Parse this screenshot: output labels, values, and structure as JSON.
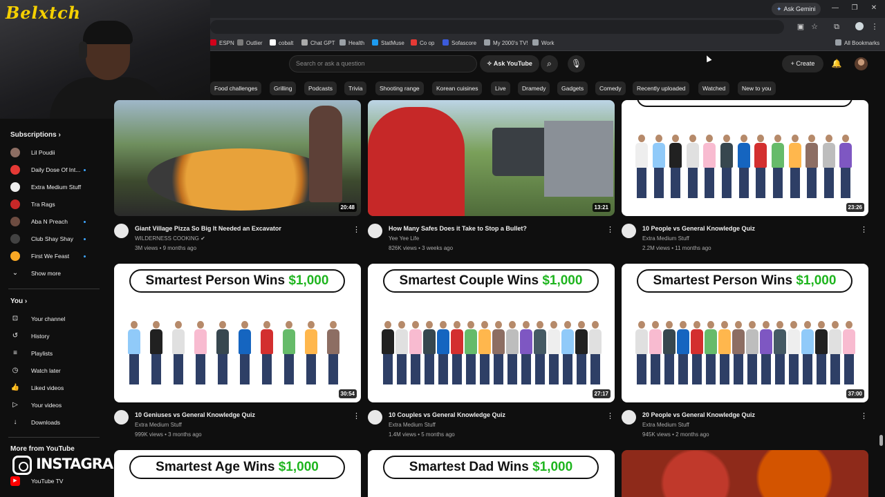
{
  "browser": {
    "ask_gemini": "Ask Gemini",
    "bookmarks": [
      {
        "label": "ESPN",
        "color": "#d0021b"
      },
      {
        "label": "Outlier",
        "color": "#7a7a7a"
      },
      {
        "label": "cobalt",
        "color": "#ffffff"
      },
      {
        "label": "Chat GPT",
        "color": "#aaaaaa"
      },
      {
        "label": "Health",
        "color": "#9aa0a6"
      },
      {
        "label": "StatMuse",
        "color": "#1d9bf0"
      },
      {
        "label": "Co op",
        "color": "#e53935"
      },
      {
        "label": "Sofascore",
        "color": "#3b5bdb"
      },
      {
        "label": "My 2000's TV!",
        "color": "#9aa0a6"
      },
      {
        "label": "Work",
        "color": "#9aa0a6"
      }
    ],
    "all_bookmarks": "All Bookmarks"
  },
  "overlay": {
    "streamer_logo": "Belxtch",
    "instagram": "INSTAGRAM"
  },
  "header": {
    "search_placeholder": "Search or ask a question",
    "ask_youtube": "Ask YouTube",
    "create": "Create"
  },
  "chips": [
    "Food challenges",
    "Grilling",
    "Podcasts",
    "Trivia",
    "Shooting range",
    "Korean cuisines",
    "Live",
    "Dramedy",
    "Gadgets",
    "Comedy",
    "Recently uploaded",
    "Watched",
    "New to you"
  ],
  "sidebar": {
    "subscriptions_title": "Subscriptions",
    "subscriptions": [
      {
        "label": "Lil Poudii",
        "icon_color": "#8d6e63",
        "new": false
      },
      {
        "label": "Daily Dose Of Int...",
        "icon_color": "#e53935",
        "new": true
      },
      {
        "label": "Extra Medium Stuff",
        "icon_color": "#eeeeee",
        "new": false
      },
      {
        "label": "Tra Rags",
        "icon_color": "#c62828",
        "new": false
      },
      {
        "label": "Aba N Preach",
        "icon_color": "#6d4c41",
        "new": true
      },
      {
        "label": "Club Shay Shay",
        "icon_color": "#424242",
        "new": true
      },
      {
        "label": "First We Feast",
        "icon_color": "#f9a825",
        "new": true
      }
    ],
    "show_more": "Show more",
    "you_title": "You",
    "you_items": [
      {
        "label": "Your channel",
        "icon": "user-square-icon"
      },
      {
        "label": "History",
        "icon": "history-icon"
      },
      {
        "label": "Playlists",
        "icon": "playlist-icon"
      },
      {
        "label": "Watch later",
        "icon": "clock-icon"
      },
      {
        "label": "Liked videos",
        "icon": "thumbs-up-icon"
      },
      {
        "label": "Your videos",
        "icon": "play-square-icon"
      },
      {
        "label": "Downloads",
        "icon": "download-icon"
      }
    ],
    "more_title": "More from YouTube",
    "more_items": [
      {
        "label": "YouTube TV",
        "icon": "youtube-tv-icon"
      }
    ]
  },
  "videos": [
    {
      "title": "Giant Village Pizza So Big It Needed an Excavator",
      "channel": "WILDERNESS COOKING",
      "verified": true,
      "stats": "3M views • 9 months ago",
      "duration": "20:48",
      "banner": "",
      "money": ""
    },
    {
      "title": "How Many Safes Does it Take to Stop a Bullet?",
      "channel": "Yee Yee Life",
      "verified": false,
      "stats": "826K views • 3 weeks ago",
      "duration": "13:21",
      "banner": "",
      "money": ""
    },
    {
      "title": "10 People vs General Knowledge Quiz",
      "channel": "Extra Medium Stuff",
      "verified": false,
      "stats": "2.2M views • 11 months ago",
      "duration": "23:26",
      "banner": "",
      "money": ""
    },
    {
      "title": "10 Geniuses vs General Knowledge Quiz",
      "channel": "Extra Medium Stuff",
      "verified": false,
      "stats": "999K views • 3 months ago",
      "duration": "30:54",
      "banner": "Smartest Person Wins ",
      "money": "$1,000"
    },
    {
      "title": "10 Couples vs General Knowledge Quiz",
      "channel": "Extra Medium Stuff",
      "verified": false,
      "stats": "1.4M views • 5 months ago",
      "duration": "27:17",
      "banner": "Smartest Couple Wins ",
      "money": "$1,000"
    },
    {
      "title": "20 People vs General Knowledge Quiz",
      "channel": "Extra Medium Stuff",
      "verified": false,
      "stats": "945K views • 2 months ago",
      "duration": "37:00",
      "banner": "Smartest Person Wins ",
      "money": "$1,000"
    },
    {
      "title": "",
      "channel": "",
      "verified": false,
      "stats": "",
      "duration": "",
      "banner": "Smartest Age Wins ",
      "money": "$1,000"
    },
    {
      "title": "",
      "channel": "",
      "verified": false,
      "stats": "",
      "duration": "",
      "banner": "Smartest Dad Wins ",
      "money": "$1,000"
    },
    {
      "title": "",
      "channel": "",
      "verified": false,
      "stats": "",
      "duration": "",
      "banner": "",
      "money": ""
    }
  ]
}
